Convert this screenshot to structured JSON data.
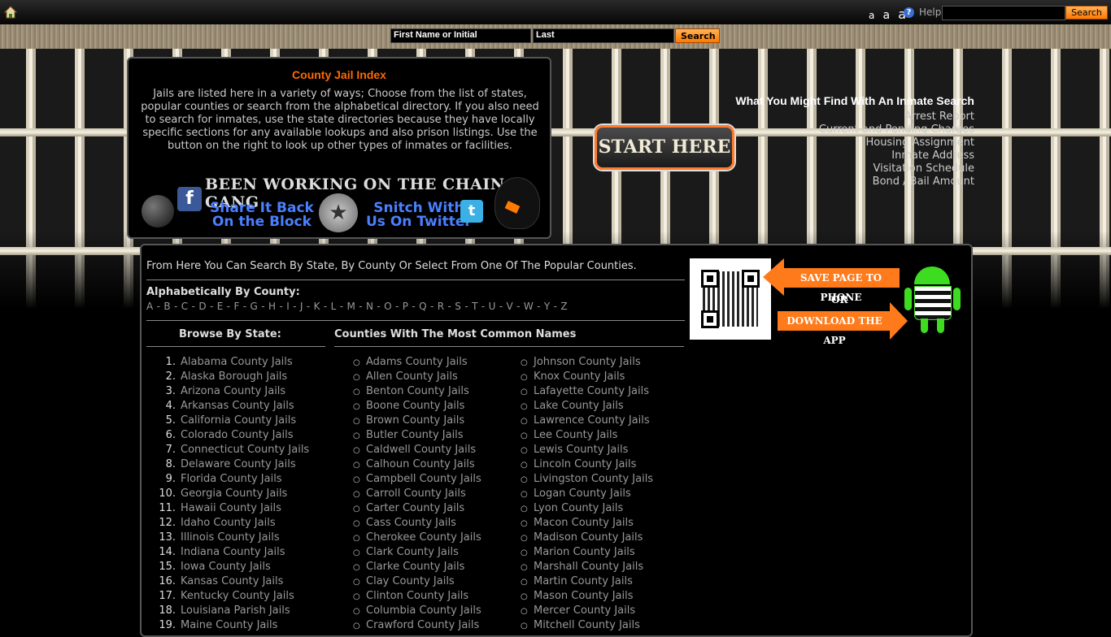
{
  "topbar": {
    "font_sizes": [
      "a",
      "a",
      "a"
    ],
    "help_label": "Help",
    "search_button": "Search"
  },
  "name_search": {
    "first_value": "First Name or Initial",
    "last_value": "Last",
    "button": "Search"
  },
  "index_panel": {
    "title": "County Jail Index",
    "text": "Jails are listed here in a variety of ways; Choose from the list of states, popular counties or search from the alphabetical directory. If you also need to search for inmates, use the state directories because they have locally specific sections for any available lookups and also prison listings. Use the button on the right to look up other types of inmates or facilities.",
    "banner_title": "BEEN WORKING ON THE CHAIN GANG",
    "share_line1": "Share It Back",
    "share_line2": "On the Block",
    "snitch_line1": "Snitch With",
    "snitch_line2": "Us On Twitter"
  },
  "start_button": "START HERE",
  "find_box": {
    "title": "What You Might Find With An Inmate Search",
    "items": [
      "Arrest Report",
      "Current and Pending Charges",
      "Housing Assignment",
      "Inmate Address",
      "Visitation Schedule",
      "Bond / Bail Amount"
    ]
  },
  "main": {
    "intro": "From Here You Can Search By State, By County Or Select From One Of The Popular Counties.",
    "alpha_label": "Alphabetically By County:",
    "letters": [
      "A",
      "B",
      "C",
      "D",
      "E",
      "F",
      "G",
      "H",
      "I",
      "J",
      "K",
      "L",
      "M",
      "N",
      "O",
      "P",
      "Q",
      "R",
      "S",
      "T",
      "U",
      "V",
      "W",
      "Y",
      "Z"
    ],
    "browse_label": "Browse By State:",
    "counties_label": "Counties With The Most Common Names",
    "states": [
      {
        "n": "1.",
        "name": "Alabama County Jails"
      },
      {
        "n": "2.",
        "name": "Alaska Borough Jails"
      },
      {
        "n": "3.",
        "name": "Arizona County Jails"
      },
      {
        "n": "4.",
        "name": "Arkansas County Jails"
      },
      {
        "n": "5.",
        "name": "California County Jails"
      },
      {
        "n": "6.",
        "name": "Colorado County Jails"
      },
      {
        "n": "7.",
        "name": "Connecticut County Jails"
      },
      {
        "n": "8.",
        "name": "Delaware County Jails"
      },
      {
        "n": "9.",
        "name": "Florida County Jails"
      },
      {
        "n": "10.",
        "name": "Georgia County Jails"
      },
      {
        "n": "11.",
        "name": "Hawaii County Jails"
      },
      {
        "n": "12.",
        "name": "Idaho County Jails"
      },
      {
        "n": "13.",
        "name": "Illinois County Jails"
      },
      {
        "n": "14.",
        "name": "Indiana County Jails"
      },
      {
        "n": "15.",
        "name": "Iowa County Jails"
      },
      {
        "n": "16.",
        "name": "Kansas County Jails"
      },
      {
        "n": "17.",
        "name": "Kentucky County Jails"
      },
      {
        "n": "18.",
        "name": "Louisiana Parish Jails"
      },
      {
        "n": "19.",
        "name": "Maine County Jails"
      }
    ],
    "counties_a": [
      "Adams County Jails",
      "Allen County Jails",
      "Benton County Jails",
      "Boone County Jails",
      "Brown County Jails",
      "Butler County Jails",
      "Caldwell County Jails",
      "Calhoun County Jails",
      "Campbell County Jails",
      "Carroll County Jails",
      "Carter County Jails",
      "Cass County Jails",
      "Cherokee County Jails",
      "Clark County Jails",
      "Clarke County Jails",
      "Clay County Jails",
      "Clinton County Jails",
      "Columbia County Jails",
      "Crawford County Jails"
    ],
    "counties_b": [
      "Johnson County Jails",
      "Knox County Jails",
      "Lafayette County Jails",
      "Lake County Jails",
      "Lawrence County Jails",
      "Lee County Jails",
      "Lewis County Jails",
      "Lincoln County Jails",
      "Livingston County Jails",
      "Logan County Jails",
      "Lyon County Jails",
      "Macon County Jails",
      "Madison County Jails",
      "Marion County Jails",
      "Marshall County Jails",
      "Martin County Jails",
      "Mason County Jails",
      "Mercer County Jails",
      "Mitchell County Jails"
    ]
  },
  "app_promo": {
    "save_text": "SAVE PAGE TO PHONE",
    "or_text": "OR",
    "download_text": "DOWNLOAD THE APP"
  }
}
